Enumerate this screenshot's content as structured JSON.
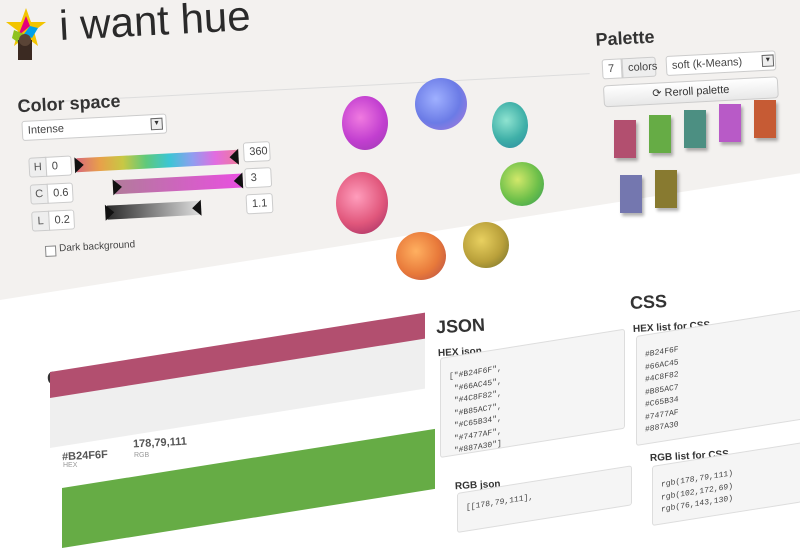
{
  "header": {
    "title": "i want hue"
  },
  "color_space": {
    "title": "Color space",
    "preset_value": "Intense",
    "h_label": "H",
    "h_min": "0",
    "h_max": "360",
    "c_label": "C",
    "c_min": "0.6",
    "c_max": "3",
    "l_label": "L",
    "l_min": "0.2",
    "l_max": "1.1",
    "dark_bg_label": "Dark background"
  },
  "palette": {
    "title": "Palette",
    "count": "7",
    "count_unit": "colors",
    "mode_value": "soft (k-Means)",
    "reroll_label": "Reroll palette",
    "swatches": [
      "#B24F6F",
      "#66AC45",
      "#4C8F82",
      "#B85AC7",
      "#C65B34",
      "#7477AF",
      "#887A30"
    ]
  },
  "colors_section": {
    "title": "Colors",
    "items": [
      {
        "hex": "#B24F6F",
        "hex_label": "HEX",
        "rgb": "178,79,111",
        "rgb_label": "RGB",
        "color": "#B24F6F"
      },
      {
        "color": "#66AC45"
      }
    ]
  },
  "json_section": {
    "title": "JSON",
    "hex_json_label": "HEX json",
    "hex_json_lines": [
      "[\"#B24F6F\",",
      "\"#66AC45\",",
      "\"#4C8F82\",",
      "\"#B85AC7\",",
      "\"#C65B34\",",
      "\"#7477AF\",",
      "\"#887A30\"]"
    ],
    "rgb_json_label": "RGB json",
    "rgb_json_first": "[[178,79,111],"
  },
  "css_section": {
    "title": "CSS",
    "hex_list_label": "HEX list for CSS",
    "hex_list": [
      "#B24F6F",
      "#66AC45",
      "#4C8F82",
      "#B85AC7",
      "#C65B34",
      "#7477AF",
      "#887A30"
    ],
    "rgb_list_label": "RGB list for CSS",
    "rgb_list": [
      "rgb(178,79,111)",
      "rgb(102,172,69)",
      "rgb(76,143,130)"
    ]
  }
}
